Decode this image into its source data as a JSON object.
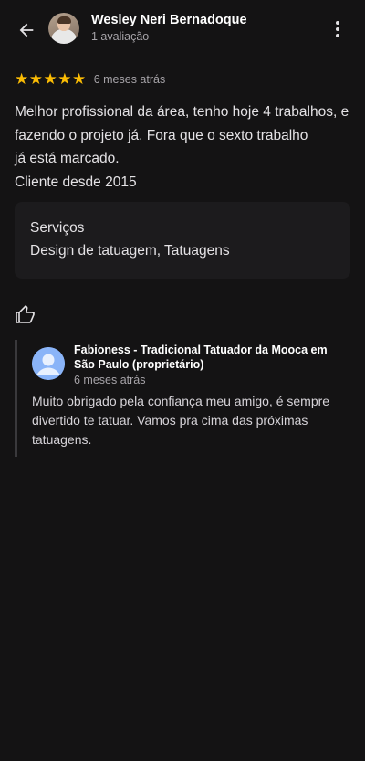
{
  "header": {
    "back_icon": "arrow-back-icon",
    "user_name": "Wesley Neri Bernadoque",
    "user_reviews": "1 avaliação",
    "more_icon": "more-vert-icon"
  },
  "review": {
    "stars": 5,
    "stars_display": "★★★★★",
    "date": "6 meses atrás",
    "text_lines": [
      "Melhor profissional da área, tenho hoje 4 trabalhos, e",
      "fazendo o projeto já. Fora que o sexto trabalho",
      "já está marcado.",
      "Cliente desde 2015"
    ]
  },
  "services": {
    "title": "Serviços",
    "value": "Design de tatuagem, Tatuagens"
  },
  "actions": {
    "like_icon": "thumb-up-icon"
  },
  "reply": {
    "avatar_icon": "default-avatar-icon",
    "owner_name": "Fabioness - Tradicional Tatuador da Mooca em São Paulo (proprietário)",
    "date": "6 meses atrás",
    "text_lines": [
      "Muito obrigado pela confiança meu amigo, é sempre",
      "divertido te tatuar. Vamos pra cima das próximas",
      "tatuagens."
    ]
  },
  "colors": {
    "background": "#141314",
    "star": "#fbbc04",
    "card": "#1c1b1d",
    "avatar_blue": "#8ab4f8"
  }
}
